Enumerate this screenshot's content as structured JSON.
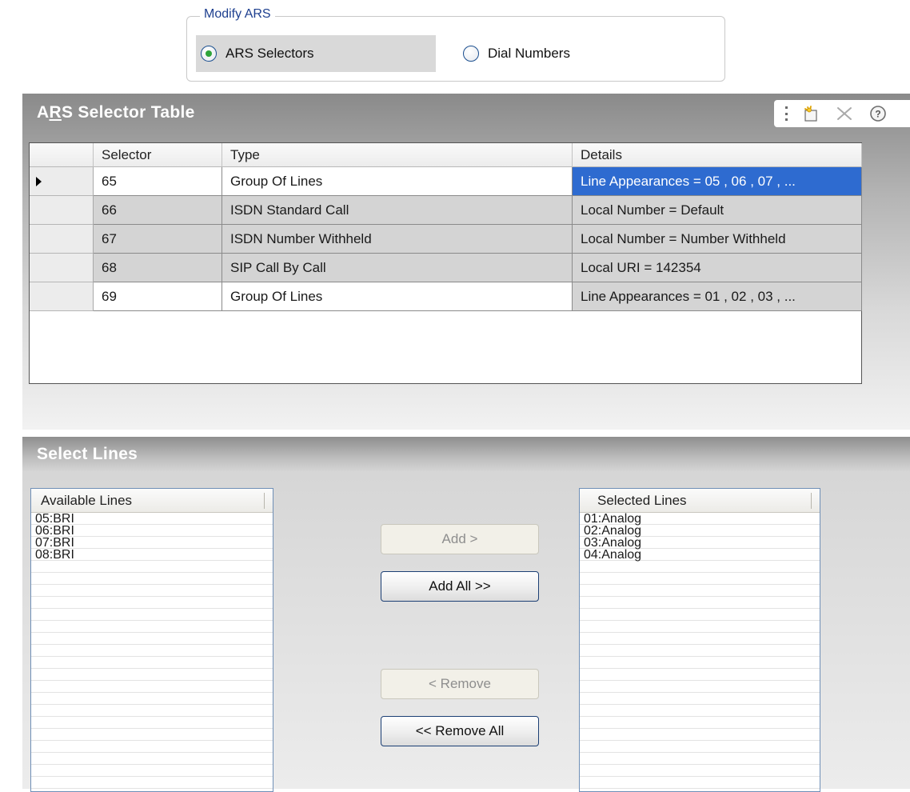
{
  "modify_ars": {
    "legend": "Modify ARS",
    "options": [
      {
        "label": "ARS Selectors",
        "selected": true
      },
      {
        "label": "Dial Numbers",
        "selected": false
      }
    ]
  },
  "ars_table": {
    "title_prefix": "A",
    "title_underlined": "R",
    "title_suffix": "S Selector Table",
    "toolbar": {
      "icons": [
        "new-item-icon",
        "delete-icon",
        "help-icon"
      ]
    },
    "columns": [
      "Selector",
      "Type",
      "Details"
    ],
    "rows": [
      {
        "selector": "65",
        "type": "Group Of Lines",
        "details": "Line Appearances = 05 , 06 , 07 , ...",
        "current": true,
        "details_highlight": true,
        "shade": "white"
      },
      {
        "selector": "66",
        "type": "ISDN Standard Call",
        "details": "Local Number = Default",
        "current": false,
        "details_highlight": false,
        "shade": "gray"
      },
      {
        "selector": "67",
        "type": "ISDN Number Withheld",
        "details": "Local Number = Number Withheld",
        "current": false,
        "details_highlight": false,
        "shade": "gray"
      },
      {
        "selector": "68",
        "type": "SIP Call By Call",
        "details": "Local URI = 142354",
        "current": false,
        "details_highlight": false,
        "shade": "gray"
      },
      {
        "selector": "69",
        "type": "Group Of Lines",
        "details": "Line Appearances = 01 , 02 , 03 , ...",
        "current": false,
        "details_highlight": false,
        "shade": "white"
      }
    ]
  },
  "select_lines": {
    "title": "Select Lines",
    "available": {
      "header": "Available Lines",
      "items": [
        "05:BRI",
        "06:BRI",
        "07:BRI",
        "08:BRI"
      ]
    },
    "selected": {
      "header": "Selected Lines",
      "items": [
        "01:Analog",
        "02:Analog",
        "03:Analog",
        "04:Analog"
      ]
    },
    "buttons": {
      "add": {
        "label": "Add >",
        "enabled": false
      },
      "add_all": {
        "label": "Add All >>",
        "enabled": true
      },
      "remove": {
        "label": "< Remove",
        "enabled": false
      },
      "remove_all": {
        "label": "<< Remove All",
        "enabled": true
      }
    }
  },
  "colors": {
    "highlight": "#2e6bd0",
    "radio_selected": "#2ea43a",
    "legend_text": "#1d3f8f"
  }
}
